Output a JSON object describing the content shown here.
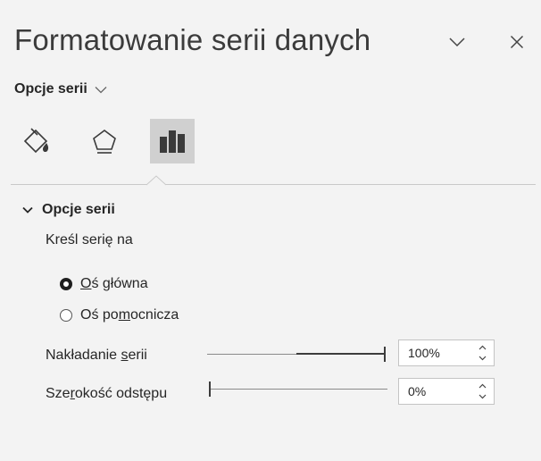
{
  "pane": {
    "title": "Formatowanie serii danych",
    "section_dropdown": "Opcje serii"
  },
  "tabs": [
    {
      "icon": "paint-bucket-icon",
      "label": "Fill & Line",
      "active": false
    },
    {
      "icon": "pentagon-effects-icon",
      "label": "Effects",
      "active": false
    },
    {
      "icon": "bar-chart-icon",
      "label": "Series Options",
      "active": true
    }
  ],
  "group": {
    "label": "Opcje serii",
    "plot_on_label": "Kreśl serię na",
    "radios": [
      {
        "prefix": "",
        "accel": "O",
        "suffix": "ś główna",
        "selected": true
      },
      {
        "prefix": "Oś po",
        "accel": "m",
        "suffix": "ocnicza",
        "selected": false
      }
    ],
    "overlap": {
      "prefix": "Nakładanie ",
      "accel": "s",
      "suffix": "erii",
      "value": "100%",
      "level": 1.0
    },
    "gap": {
      "prefix": "Sze",
      "accel": "r",
      "suffix": "okość odstępu",
      "value": "0%",
      "level": 0.0
    }
  },
  "colors": {
    "background": "#f3f3f3",
    "active_tab": "#d0d0d0",
    "text": "#262626"
  }
}
